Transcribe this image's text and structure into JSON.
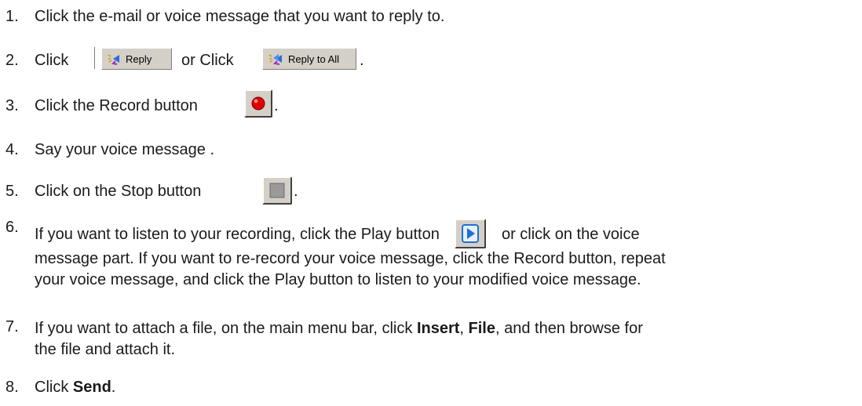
{
  "steps": [
    {
      "num": "1.",
      "text": "Click the e-mail or voice message that you want to reply to."
    },
    {
      "num": "2.",
      "pre": "Click",
      "mid": "or Click",
      "post": ".",
      "reply_label": "Reply",
      "reply_all_label": "Reply to All"
    },
    {
      "num": "3.",
      "pre": "Click the Record button",
      "post": "."
    },
    {
      "num": "4.",
      "text": "Say your voice message ."
    },
    {
      "num": "5.",
      "pre": "Click on the Stop button",
      "post": "."
    },
    {
      "num": "6.",
      "line1_pre": "If you want to listen to your recording, click the Play button",
      "line1_post": "or click on the voice",
      "line2": "message part. If you want to re-record your voice message, click the Record button, repeat",
      "line3": "your voice message, and click the Play button to listen to your modified voice message."
    },
    {
      "num": "7.",
      "a": "If you want to attach a file, on the main menu bar, click ",
      "insert": "Insert",
      "comma": ", ",
      "file": "File",
      "b": ", and then browse for",
      "line2": "the file and attach it."
    },
    {
      "num": "8.",
      "pre": "Click ",
      "send": "Send",
      "post": "."
    }
  ],
  "colors": {
    "record_dot": "#e00000",
    "button_face": "#d4d0c8",
    "play_arrow": "#1f6fd6"
  },
  "icons": [
    "reply-icon",
    "reply-all-icon",
    "record-icon",
    "stop-icon",
    "play-icon"
  ]
}
